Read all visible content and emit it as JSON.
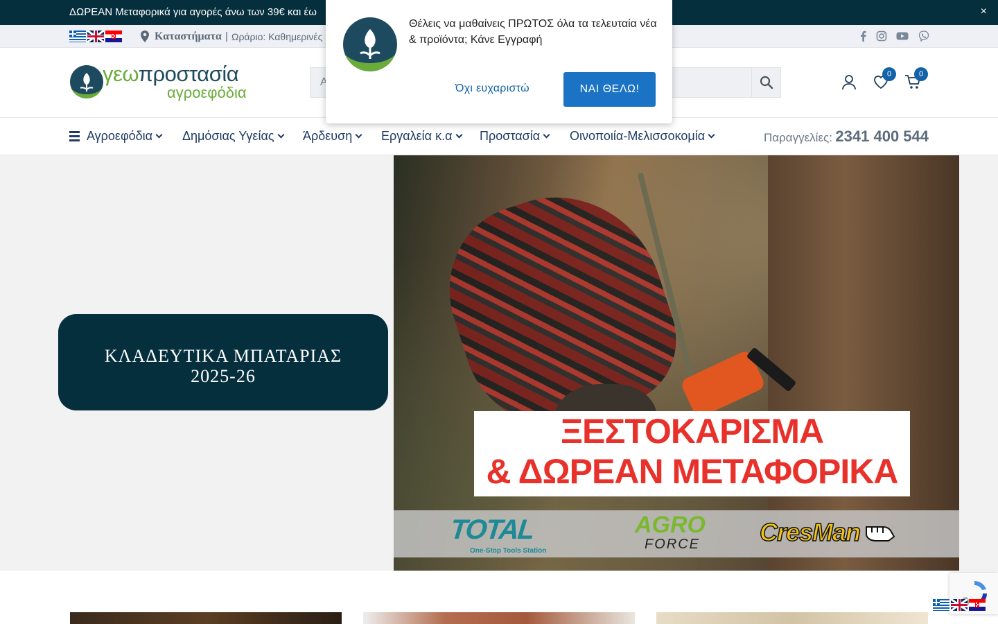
{
  "announcement": {
    "text": "ΔΩΡΕΑΝ Μεταφορικά για αγορές άνω των 39€ και έω",
    "close_label": "×"
  },
  "infobar": {
    "stores_label": "Καταστήματα",
    "separator": "|",
    "hours_text": "Ωράριο: Καθημερινές",
    "languages": [
      "el",
      "en",
      "hr"
    ],
    "social": [
      "facebook-icon",
      "instagram-icon",
      "youtube-icon",
      "viber-icon"
    ]
  },
  "header": {
    "logo_main_prefix": "γεω",
    "logo_main_rest": "προστασία",
    "logo_sub": "αγροεφόδια",
    "search_placeholder": "Α",
    "wishlist_count": "0",
    "cart_count": "0"
  },
  "nav": {
    "items": [
      {
        "label": "Αγροεφόδια"
      },
      {
        "label": "Δημόσιας Υγείας"
      },
      {
        "label": "Άρδευση"
      },
      {
        "label": "Εργαλεία κ.α"
      },
      {
        "label": "Προστασία"
      },
      {
        "label": "Οινοποιία-Μελισσοκομία"
      }
    ],
    "orders_label": "Παραγγελίες:",
    "orders_phone": "2341 400 544"
  },
  "hero": {
    "card_line1": "ΚΛΑΔΕΥΤΙΚΑ ΜΠΑΤΑΡΙΑΣ",
    "card_line2": "2025-26",
    "promo_line1": "ΞΕΣΤΟΚΑΡΙΣΜΑ",
    "promo_line2": "& ΔΩΡΕΑΝ ΜΕΤΑΦΟΡΙΚΑ",
    "brands": {
      "total": "TOTAL",
      "total_tagline": "One-Stop Tools Station",
      "agro": "AGRO",
      "force": "FORCE",
      "cresman": "CresMan"
    }
  },
  "popup": {
    "message": "Θέλεις να μαθαίνεις ΠΡΩΤΟΣ όλα τα τελευταία νέα & προϊόντα; Κάνε Εγγραφή",
    "decline_label": "Όχι ευχαριστώ",
    "accept_label": "ΝΑΙ ΘΕΛΩ!"
  },
  "colors": {
    "brand_dark": "#062f3e",
    "brand_green": "#6bab3a",
    "accent_blue": "#1a73c4",
    "promo_red": "#e8312b"
  }
}
